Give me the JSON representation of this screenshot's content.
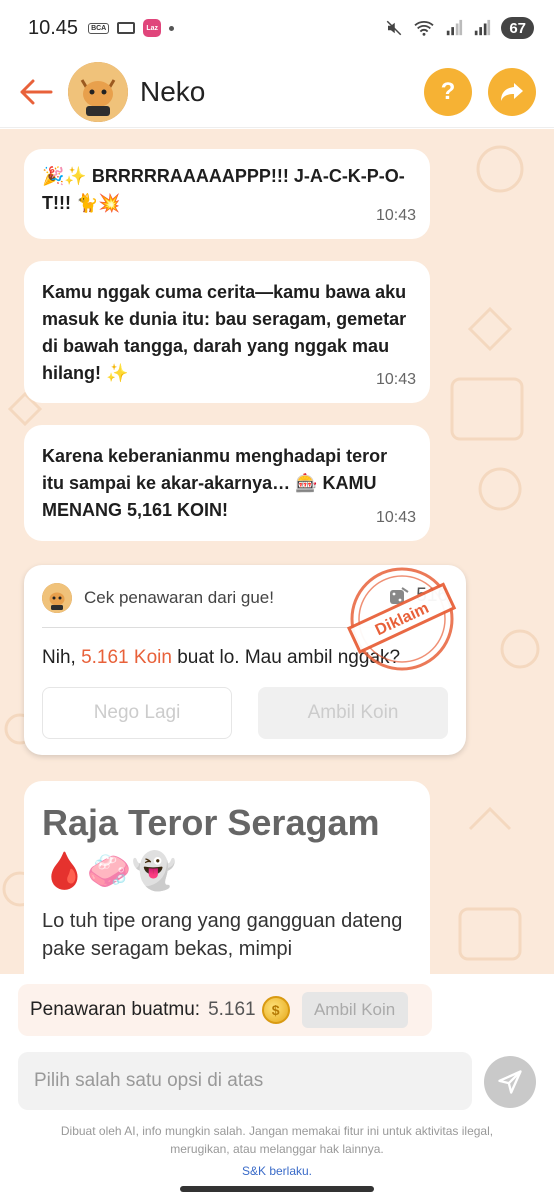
{
  "status_bar": {
    "time": "10.45",
    "bank_icon_text": "BCA",
    "app_icon_text": "Laz",
    "battery": "67"
  },
  "header": {
    "title": "Neko",
    "help_label": "?"
  },
  "messages": [
    {
      "text": "🎉✨ BRRRRRAAAAAPPP!!! J-A-C-K-P-O-T!!! 🐈💥",
      "time": "10:43"
    },
    {
      "text": "Kamu nggak cuma cerita—kamu bawa aku masuk ke dunia itu: bau seragam, gemetar di bawah tangga, darah yang nggak mau hilang! ✨",
      "time": "10:43"
    },
    {
      "text": "Karena keberanianmu menghadapi teror itu sampai ke akar-akarnya… 🎰 KAMU MENANG 5,161 KOIN!",
      "time": "10:43"
    }
  ],
  "offer": {
    "header": "Cek penawaran dari gue!",
    "count": "516",
    "text_prefix": "Nih, ",
    "amount": "5.161 Koin",
    "text_suffix": " buat lo. Mau ambil nggak?",
    "nego_label": "Nego Lagi",
    "ambil_label": "Ambil Koin",
    "stamp": "Diklaim"
  },
  "result": {
    "title": "Raja Teror Seragam",
    "emoji": "🩸🧼👻",
    "body": "Lo tuh tipe orang yang gangguan dateng pake seragam bekas, mimpi"
  },
  "negotiation": {
    "label": "Penawaran buatmu:",
    "amount": "5.161",
    "coin_symbol": "$",
    "button": "Ambil Koin"
  },
  "input": {
    "placeholder": "Pilih salah satu opsi di atas"
  },
  "footer": {
    "disclaimer": "Dibuat oleh AI, info mungkin salah. Jangan memakai fitur ini untuk aktivitas ilegal, merugikan, atau melanggar hak lainnya.",
    "terms": "S&K berlaku."
  },
  "colors": {
    "accent": "#e8613a",
    "header_button": "#f6b234",
    "chat_bg": "#fbe9da"
  }
}
